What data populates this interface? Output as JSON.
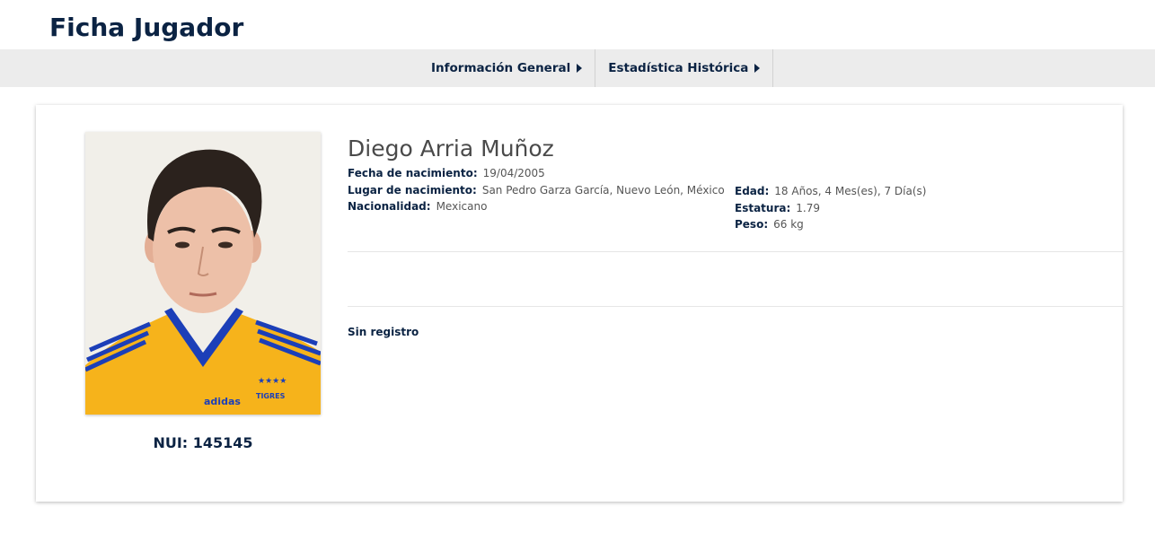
{
  "page": {
    "title": "Ficha Jugador"
  },
  "nav": {
    "tabs": [
      {
        "label": "Información General"
      },
      {
        "label": "Estadística Histórica"
      }
    ]
  },
  "player": {
    "name": "Diego Arria Muñoz",
    "nui_label": "NUI: 145145",
    "birth_date": {
      "label": "Fecha de nacimiento:",
      "value": "19/04/2005"
    },
    "birth_place": {
      "label": "Lugar de nacimiento:",
      "value": "San Pedro Garza García, Nuevo León, México"
    },
    "nationality": {
      "label": "Nacionalidad:",
      "value": "Mexicano"
    },
    "age": {
      "label": "Edad:",
      "value": "18 Años, 4 Mes(es), 7 Día(s)"
    },
    "height": {
      "label": "Estatura:",
      "value": "1.79"
    },
    "weight": {
      "label": "Peso:",
      "value": "66 kg"
    },
    "jersey_brand": "adidas",
    "jersey_team": "TIGRES"
  },
  "records": {
    "empty_text": "Sin registro"
  },
  "colors": {
    "primary": "#0b2343",
    "navbar_bg": "#ececec",
    "jersey_yellow": "#f6b31b",
    "jersey_blue": "#1c3fb8"
  }
}
